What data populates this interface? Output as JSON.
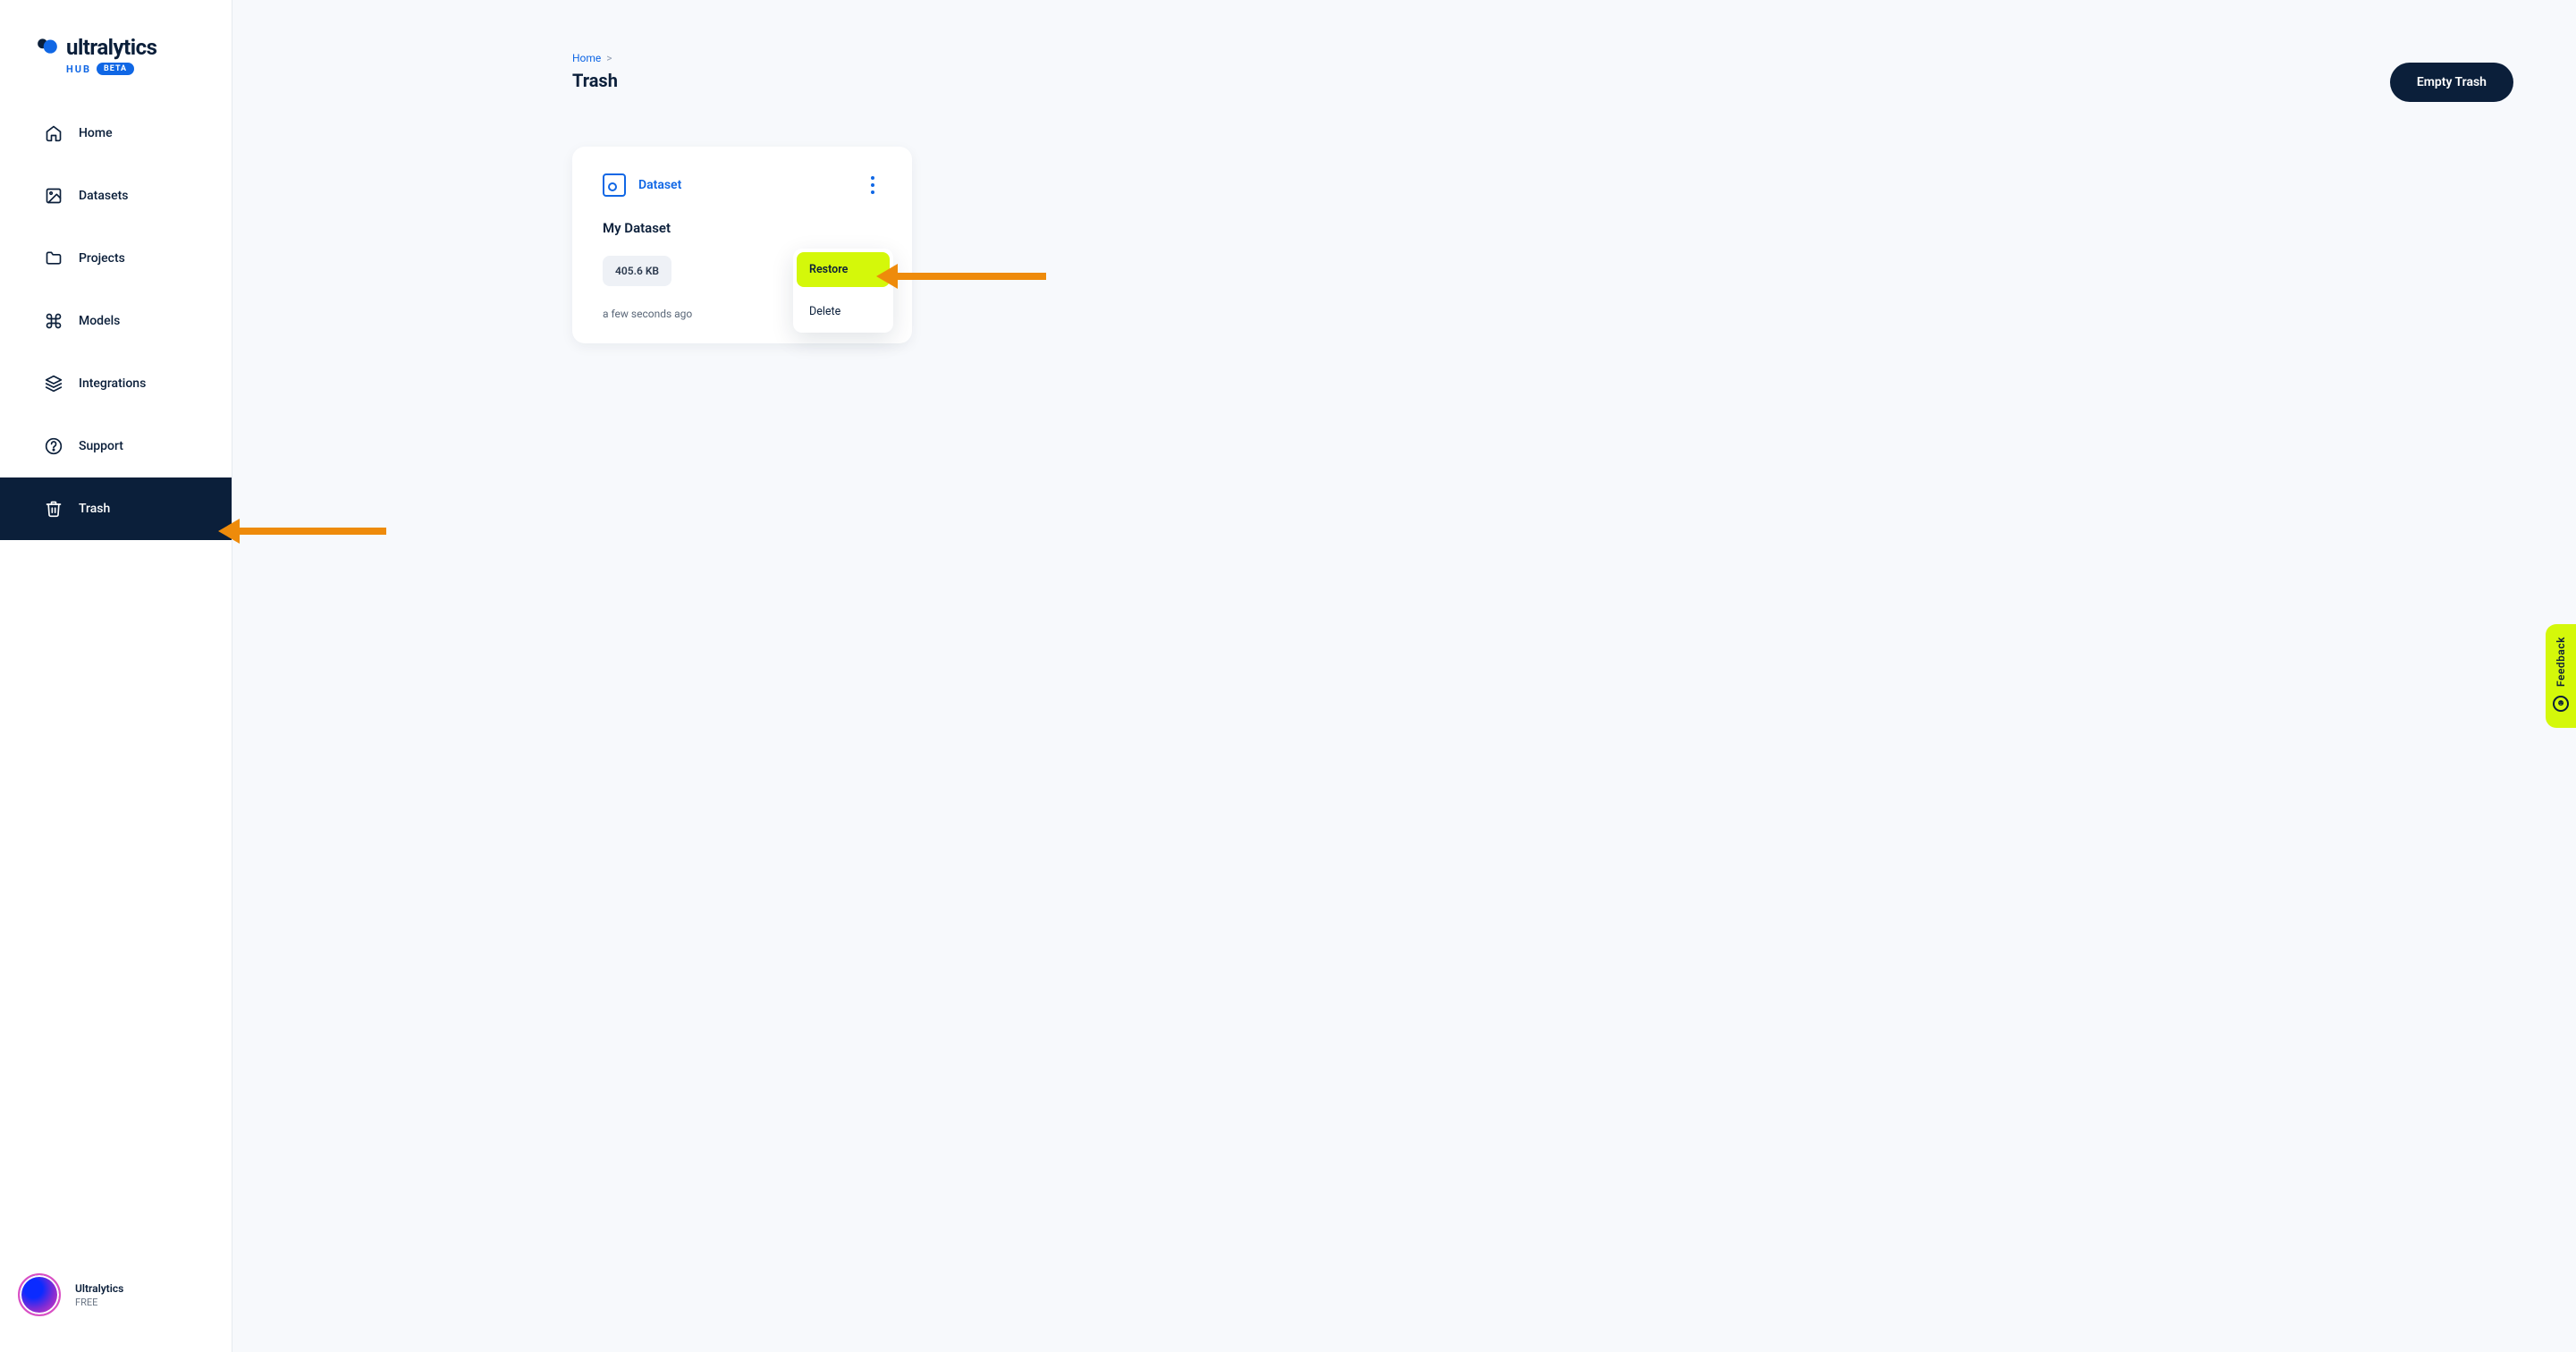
{
  "brand": {
    "name": "ultralytics",
    "sub": "HUB",
    "badge": "BETA"
  },
  "sidebar": {
    "items": [
      {
        "label": "Home",
        "icon": "home"
      },
      {
        "label": "Datasets",
        "icon": "image"
      },
      {
        "label": "Projects",
        "icon": "folder"
      },
      {
        "label": "Models",
        "icon": "command"
      },
      {
        "label": "Integrations",
        "icon": "layers"
      },
      {
        "label": "Support",
        "icon": "help"
      },
      {
        "label": "Trash",
        "icon": "trash"
      }
    ]
  },
  "user": {
    "name": "Ultralytics",
    "plan": "FREE"
  },
  "breadcrumb": {
    "home": "Home",
    "sep": ">"
  },
  "page": {
    "title": "Trash",
    "empty_btn": "Empty Trash"
  },
  "card": {
    "type_label": "Dataset",
    "name": "My Dataset",
    "size": "405.6 KB",
    "age": "a few seconds ago"
  },
  "ctx": {
    "restore": "Restore",
    "delete": "Delete"
  },
  "feedback": {
    "label": "Feedback"
  }
}
